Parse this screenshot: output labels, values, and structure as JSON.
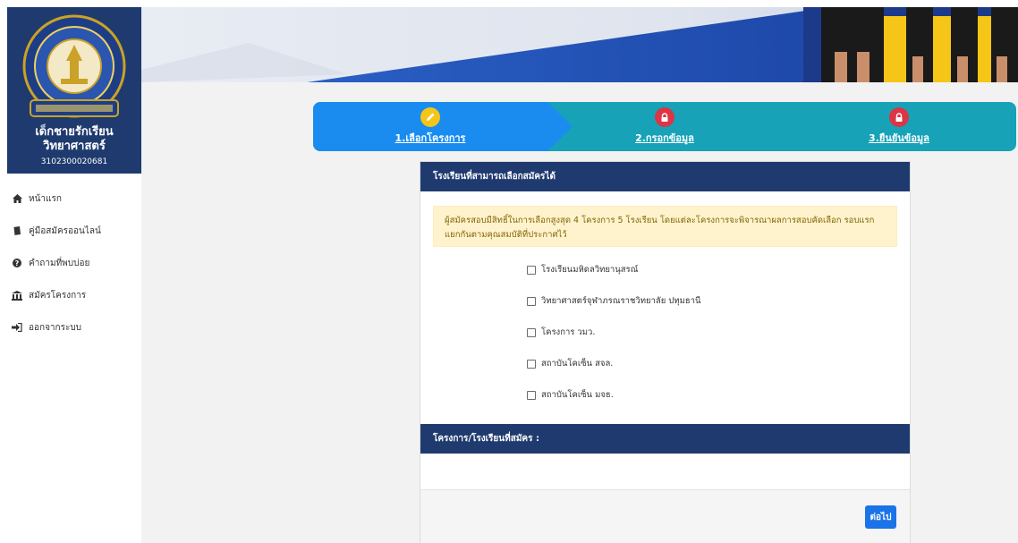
{
  "profile": {
    "name": "เด็กชายรักเรียน วิทยาศาสตร์",
    "student_id": "3102300020681"
  },
  "menu": [
    {
      "label": "หน้าแรก",
      "icon": "home-icon"
    },
    {
      "label": "คู่มือสมัครออนไลน์",
      "icon": "book-icon"
    },
    {
      "label": "คำถามที่พบบ่อย",
      "icon": "question-circle-icon"
    },
    {
      "label": "สมัครโครงการ",
      "icon": "institution-icon"
    },
    {
      "label": "ออกจากระบบ",
      "icon": "sign-out-icon"
    }
  ],
  "stepper": {
    "steps": [
      {
        "label": "1.เลือกโครงการ",
        "icon": "pencil-icon",
        "state": "active"
      },
      {
        "label": "2.กรอกข้อมูล",
        "icon": "lock-icon",
        "state": "locked"
      },
      {
        "label": "3.ยืนยันข้อมูล",
        "icon": "lock-icon",
        "state": "locked"
      }
    ]
  },
  "schools_card": {
    "title": "โรงเรียนที่สามารถเลือกสมัครได้",
    "alert": "ผู้สมัครสอบมีสิทธิ์ในการเลือกสูงสุด 4 โครงการ 5 โรงเรียน โดยแต่ละโครงการจะพิจารณาผลการสอบคัดเลือก รอบแรกแยกกันตามคุณสมบัติที่ประกาศไว้",
    "options": [
      "โรงเรียนมหิดลวิทยานุสรณ์",
      "วิทยาศาสตร์จุฬาภรณราชวิทยาลัย ปทุมธานี",
      "โครงการ วมว.",
      "สถาบันโคเซ็น สจล.",
      "สถาบันโคเซ็น มจธ."
    ]
  },
  "applied_card": {
    "title": "โครงการ/โรงเรียนที่สมัคร :"
  },
  "next_button": "ต่อไป",
  "colors": {
    "navy": "#1f3a6e",
    "step_active": "#1a8cf0",
    "step_inactive": "#17a2b8",
    "lock_red": "#dc3545",
    "pencil_yellow": "#f5c518",
    "button_blue": "#1a73e8"
  }
}
